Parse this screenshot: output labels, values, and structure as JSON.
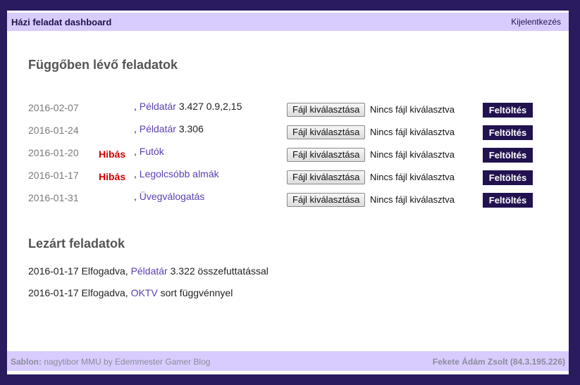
{
  "header": {
    "title": "Házi feladat dashboard",
    "logout_label": "Kijelentkezés"
  },
  "pending": {
    "title": "Függőben lévő feladatok",
    "rows": [
      {
        "date": "2016-02-07",
        "status": "",
        "prefix": ", ",
        "link": "Példatár",
        "suffix": " 3.427 0.9,2,15",
        "file_button": "Fájl kiválasztása",
        "file_status": "Nincs fájl kiválasztva",
        "upload": "Feltöltés"
      },
      {
        "date": "2016-01-24",
        "status": "",
        "prefix": ", ",
        "link": "Példatár",
        "suffix": " 3.306",
        "file_button": "Fájl kiválasztása",
        "file_status": "Nincs fájl kiválasztva",
        "upload": "Feltöltés"
      },
      {
        "date": "2016-01-20",
        "status": "Hibás",
        "prefix": ", ",
        "link": "Futók",
        "suffix": "",
        "file_button": "Fájl kiválasztása",
        "file_status": "Nincs fájl kiválasztva",
        "upload": "Feltöltés"
      },
      {
        "date": "2016-01-17",
        "status": "Hibás",
        "prefix": ", ",
        "link": "Legolcsóbb almák",
        "suffix": "",
        "file_button": "Fájl kiválasztása",
        "file_status": "Nincs fájl kiválasztva",
        "upload": "Feltöltés"
      },
      {
        "date": "2016-01-31",
        "status": "",
        "prefix": ", ",
        "link": "Üvegválogatás",
        "suffix": "",
        "file_button": "Fájl kiválasztása",
        "file_status": "Nincs fájl kiválasztva",
        "upload": "Feltöltés"
      }
    ]
  },
  "closed": {
    "title": "Lezárt feladatok",
    "rows": [
      {
        "prefix": "2016-01-17 Elfogadva, ",
        "link": "Példatár",
        "suffix": " 3.322 összefuttatással"
      },
      {
        "prefix": "2016-01-17 Elfogadva, ",
        "link": "OKTV",
        "suffix": " sort függvénnyel"
      }
    ]
  },
  "footer": {
    "template_label": "Sablon:",
    "template_text": " nagytibor MMU by Edemmester Gamer Blog",
    "user": "Fekete Ádám Zsolt (84.3.195.226)"
  },
  "colors": {
    "background": "#2a1a5e",
    "bar": "#d8ccff",
    "link": "#5b3fb0",
    "error": "#d00000",
    "upload_button": "#22124f"
  }
}
